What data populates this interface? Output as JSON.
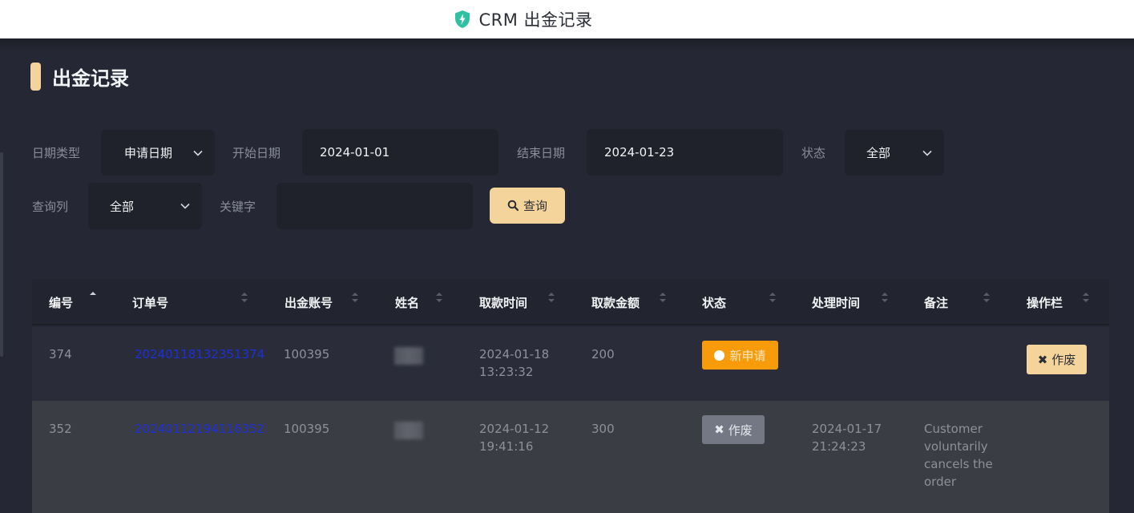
{
  "app": {
    "window_title": "CRM 出金记录",
    "shield_color": "#30c2a0"
  },
  "page": {
    "title": "出金记录"
  },
  "filters": {
    "date_type_label": "日期类型",
    "date_type_value": "申请日期",
    "start_date_label": "开始日期",
    "start_date_value": "2024-01-01",
    "end_date_label": "结束日期",
    "end_date_value": "2024-01-23",
    "status_label": "状态",
    "status_value": "全部",
    "query_column_label": "查询列",
    "query_column_value": "全部",
    "keyword_label": "关键字",
    "keyword_value": "",
    "search_button": "查询"
  },
  "table": {
    "columns": [
      "编号",
      "订单号",
      "出金账号",
      "姓名",
      "取款时间",
      "取款金额",
      "状态",
      "处理时间",
      "备注",
      "操作栏"
    ],
    "rows": [
      {
        "id": "374",
        "order_no": "20240118132351374",
        "account": "100395",
        "name": "",
        "withdraw_date": "2024-01-18",
        "withdraw_time": "13:23:32",
        "amount": "200",
        "status": "新申请",
        "processed_date": "",
        "processed_time": "",
        "remark": "",
        "action": "作废"
      },
      {
        "id": "352",
        "order_no": "20240112194116352",
        "account": "100395",
        "name": "",
        "withdraw_date": "2024-01-12",
        "withdraw_time": "19:41:16",
        "amount": "300",
        "status": "作废",
        "processed_date": "2024-01-17",
        "processed_time": "21:24:23",
        "remark_lines": [
          "Customer",
          "voluntarily",
          "cancels the",
          "order"
        ],
        "action": ""
      }
    ]
  },
  "colors": {
    "accent": "#f5d49b",
    "status_new": "#f79b0b",
    "status_void": "#737884",
    "link": "#1c2fd8"
  }
}
